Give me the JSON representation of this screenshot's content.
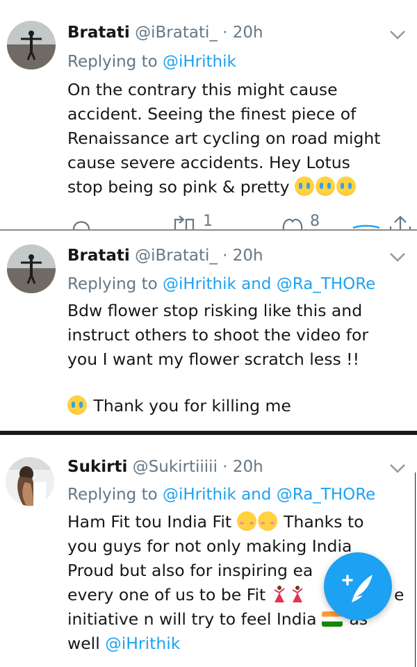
{
  "tweets": [
    {
      "name": "Bratati",
      "handle": "@iBratati_",
      "time": "· 20h",
      "replying_prefix": "Replying to",
      "replying_to": "@iHrithik",
      "lines": [
        "On the contrary this might cause",
        "accident. Seeing the finest piece of",
        "Renaissance art cycling on road might",
        "cause severe accidents. Hey Lotus",
        "stop being so pink & pretty"
      ],
      "emoji": "crying-face",
      "actions": {
        "retweets": "1",
        "likes": "8"
      }
    },
    {
      "name": "Bratati",
      "handle": "@iBratati_",
      "time": "· 20h",
      "replying_prefix": "Replying to",
      "replying_to": "@iHrithik and @Ra_THORe",
      "lines": [
        "Bdw flower stop risking like this and",
        "instruct others to shoot the video for",
        "you I want my flower scratch less !!"
      ],
      "last_line": "Thank you for killing me",
      "emoji": "crying-face"
    },
    {
      "name": "Sukirti",
      "handle": "@Sukirtiiiii",
      "time": "· 20h",
      "replying_prefix": "Replying to",
      "replying_to": "@iHrithik and @Ra_THORe",
      "line1": "Ham Fit tou India Fit",
      "line1_tail": "Thanks to",
      "line2": "you guys for not only making India",
      "line3": "Proud but also for inspiring ea",
      "line4": "every one of us to be Fit",
      "line4_tail": "e",
      "line5": "initiative n will try to feel India",
      "line5_tail": "as",
      "line6": "well",
      "line6_link": "@iHrithik"
    }
  ],
  "icons": [
    "chevron-down-icon",
    "reply-icon",
    "retweet-icon",
    "like-icon",
    "share-icon",
    "compose-tweet-icon"
  ],
  "colors": {
    "accent": "#1da1f2",
    "secondary_text": "#657786",
    "divider": "#2b2b2b"
  }
}
